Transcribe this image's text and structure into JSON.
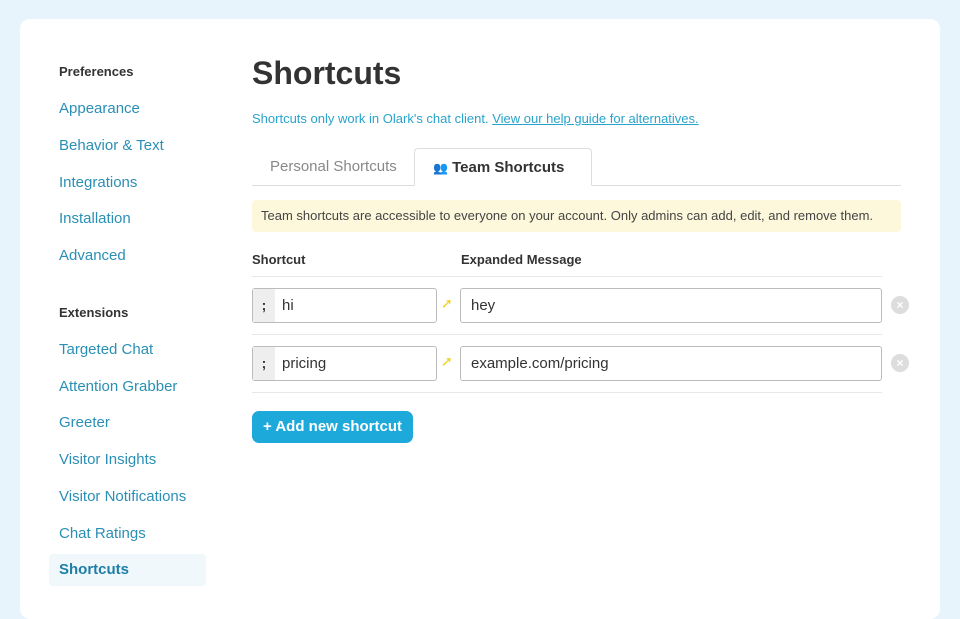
{
  "sidebar": {
    "preferences_title": "Preferences",
    "preferences": [
      "Appearance",
      "Behavior & Text",
      "Integrations",
      "Installation",
      "Advanced"
    ],
    "extensions_title": "Extensions",
    "extensions": [
      "Targeted Chat",
      "Attention Grabber",
      "Greeter",
      "Visitor Insights",
      "Visitor Notifications",
      "Chat Ratings",
      "Shortcuts"
    ],
    "active": "Shortcuts"
  },
  "main": {
    "title": "Shortcuts",
    "note": "Shortcuts only work in Olark's chat client.",
    "note_link": "View our help guide for alternatives.",
    "tabs": [
      {
        "label": "Personal Shortcuts"
      },
      {
        "label": "Team Shortcuts",
        "icon": "team-icon",
        "active": true
      }
    ],
    "info": "Team shortcuts are accessible to everyone on your account. Only admins can add, edit, and remove them.",
    "col_shortcut": "Shortcut",
    "col_message": "Expanded Message",
    "rows": [
      {
        "prefix": ";",
        "shortcut": "hi",
        "message": "hey"
      },
      {
        "prefix": ";",
        "shortcut": "pricing",
        "message": "example.com/pricing"
      }
    ],
    "add_label": "+ Add new shortcut"
  },
  "colors": {
    "accent": "#1ea9db",
    "link": "#2a8fb5",
    "info_bg": "#fdf8dc"
  }
}
